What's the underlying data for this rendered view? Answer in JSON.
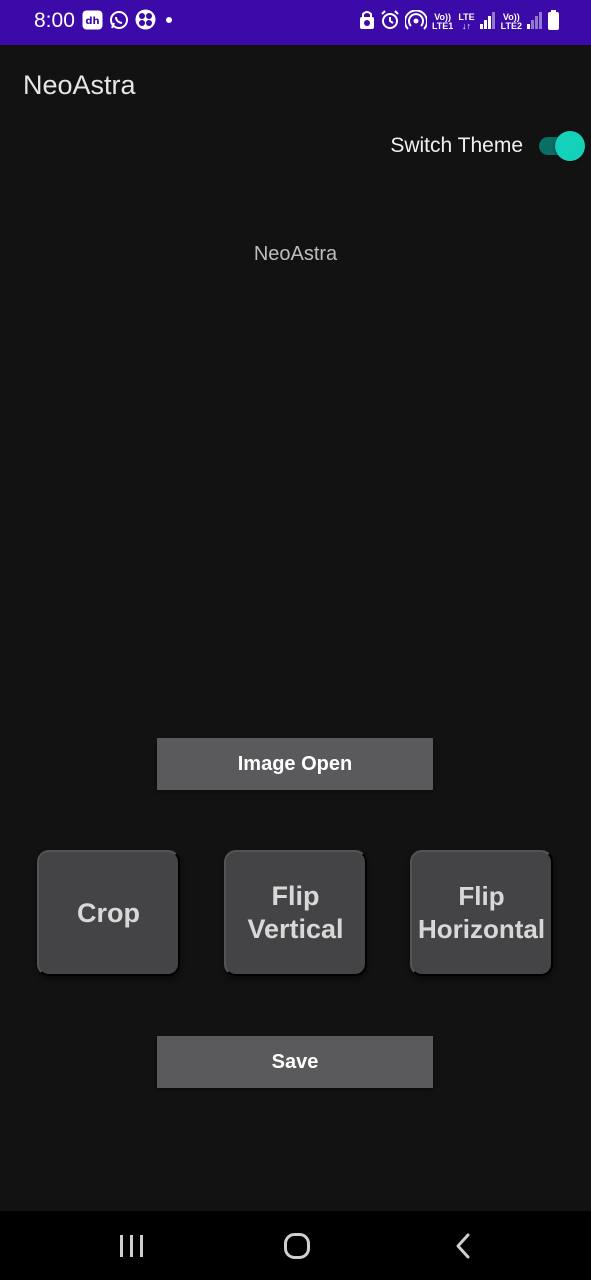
{
  "status_bar": {
    "time": "8:00",
    "left_icons": [
      "dh-app-icon",
      "whatsapp-icon",
      "fan-icon",
      "dot-icon"
    ],
    "right_icons": [
      "lock-clock-icon",
      "alarm-icon",
      "hotspot-icon",
      "volte-lte1-icon",
      "lte-data-icon",
      "signal1-icon",
      "volte-lte2-icon",
      "signal2-icon",
      "battery-icon"
    ],
    "volte1_top": "Vo))",
    "volte1_bottom": "LTE1",
    "lte_label": "LTE",
    "volte2_top": "Vo))",
    "volte2_bottom": "LTE2",
    "color": "#3b0aa8"
  },
  "app": {
    "title": "NeoAstra",
    "theme_switch_label": "Switch Theme",
    "theme_switch_on": true,
    "image_placeholder_text": "NeoAstra",
    "accent": "#14d1b9"
  },
  "actions": {
    "image_open": "Image Open",
    "crop": "Crop",
    "flip_vertical_line1": "Flip",
    "flip_vertical_line2": "Vertical",
    "flip_horizontal_line1": "Flip",
    "flip_horizontal_line2": "Horizontal",
    "save": "Save"
  },
  "nav_bar": {
    "items": [
      "recent-apps-icon",
      "home-icon",
      "back-icon"
    ]
  }
}
